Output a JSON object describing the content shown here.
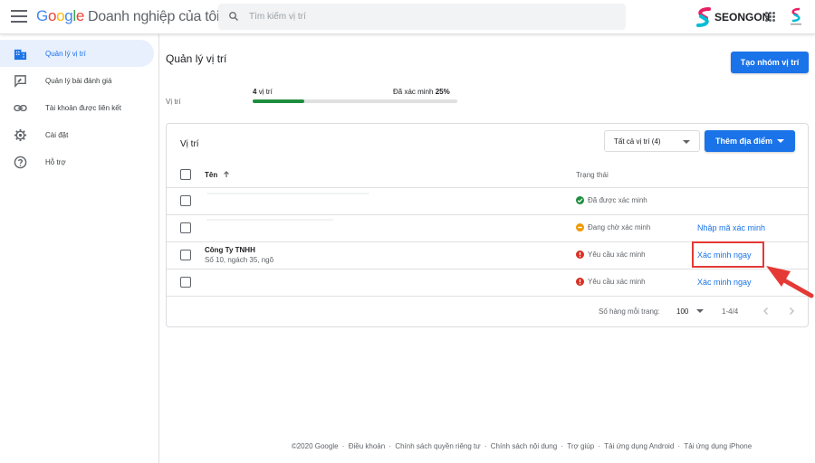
{
  "app": {
    "logo_google": [
      "G",
      "o",
      "o",
      "g",
      "l",
      "e"
    ],
    "product_name": "Doanh nghiệp của tôi",
    "brand_name": "SEONGON"
  },
  "search": {
    "placeholder": "Tìm kiếm vị trí"
  },
  "sidebar": {
    "items": [
      {
        "label": "Quản lý vị trí",
        "icon": "building-icon",
        "active": true
      },
      {
        "label": "Quản lý bài đánh giá",
        "icon": "review-icon",
        "active": false
      },
      {
        "label": "Tài khoản được liên kết",
        "icon": "link-icon",
        "active": false
      },
      {
        "label": "Cài đặt",
        "icon": "gear-icon",
        "active": false
      },
      {
        "label": "Hỗ trợ",
        "icon": "help-icon",
        "active": false
      }
    ]
  },
  "main": {
    "title": "Quản lý vị trí",
    "create_group_button": "Tạo nhóm vị trí",
    "summary": {
      "label": "Vị trí",
      "count_number": "4",
      "count_unit": "vị trí",
      "verified_label": "Đã xác minh",
      "verified_percent": "25%",
      "progress_fraction": 0.25
    }
  },
  "card": {
    "title": "Vị trí",
    "filter_label": "Tất cả vị trí (4)",
    "add_location_button": "Thêm địa điểm",
    "columns": {
      "name": "Tên",
      "status": "Trạng thái"
    },
    "rows": [
      {
        "name": "",
        "address": "",
        "status": "Đã được xác minh",
        "status_type": "verified",
        "action": ""
      },
      {
        "name": "",
        "address": "",
        "status": "Đang chờ xác minh",
        "status_type": "pending",
        "action": "Nhập mã xác minh"
      },
      {
        "name": "Công Ty TNHH",
        "address": "Số 10, ngách 35, ngõ",
        "status": "Yêu cầu xác minh",
        "status_type": "required",
        "action": "Xác minh ngay"
      },
      {
        "name": "",
        "address": "",
        "status": "Yêu cầu xác minh",
        "status_type": "required",
        "action": "Xác minh ngay"
      }
    ],
    "pagination": {
      "rows_per_page_label": "Số hàng mỗi trang:",
      "rows_per_page_value": "100",
      "range": "1-4/4"
    }
  },
  "footer": {
    "items": [
      "©2020 Google",
      "Điều khoản",
      "Chính sách quyền riêng tư",
      "Chính sách nội dung",
      "Trợ giúp",
      "Tải ứng dụng Android",
      "Tải ứng dụng iPhone"
    ],
    "separator": "·"
  },
  "colors": {
    "accent": "#1a73e8",
    "verified": "#1e8e3e",
    "pending": "#f29900",
    "required": "#d93025",
    "highlight": "#e53935"
  }
}
